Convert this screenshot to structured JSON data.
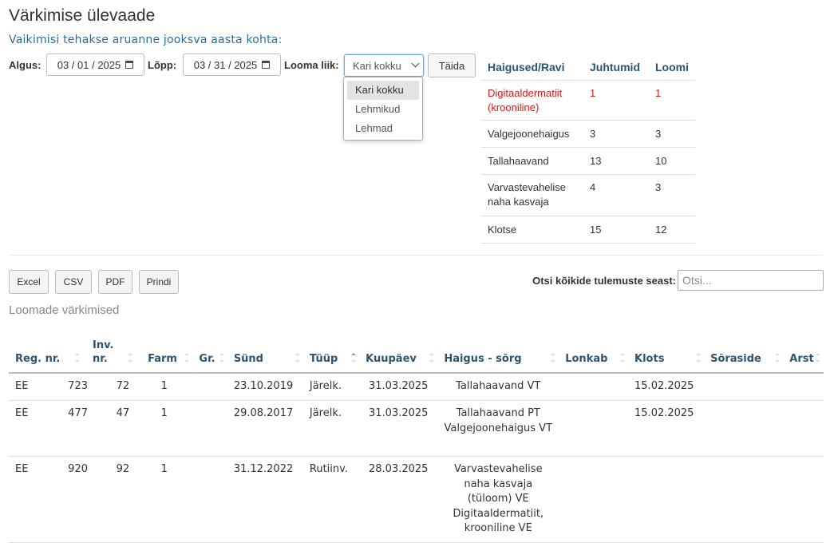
{
  "page": {
    "title": "Värkimise ülevaade",
    "subtitle": "Vaikimisi tehakse aruanne jooksva aasta kohta:"
  },
  "filters": {
    "start_label": "Algus:",
    "start_value": "03 / 01 / 2025",
    "end_label": "Lõpp:",
    "end_value": "03 / 31 / 2025",
    "type_label": "Looma liik:",
    "type_value": "Kari kokku",
    "type_options": [
      "Kari kokku",
      "Lehmikud",
      "Lehmad"
    ],
    "submit_label": "Täida"
  },
  "summary": {
    "headers": [
      "Haigused/Ravi",
      "Juhtumid",
      "Loomi"
    ],
    "rows": [
      {
        "name": "Digitaaldermatiit (krooniline)",
        "cases": "1",
        "animals": "1",
        "highlight": true
      },
      {
        "name": "Valgejoonehaigus",
        "cases": "3",
        "animals": "3"
      },
      {
        "name": "Tallahaavand",
        "cases": "13",
        "animals": "10"
      },
      {
        "name": "Varvastevahelise naha kasvaja",
        "cases": "4",
        "animals": "3"
      },
      {
        "name": "Klotse",
        "cases": "15",
        "animals": "12"
      }
    ]
  },
  "toolbar": {
    "excel": "Excel",
    "csv": "CSV",
    "pdf": "PDF",
    "print": "Prindi",
    "search_label": "Otsi kõikide tulemuste seast:",
    "search_placeholder": "Otsi..."
  },
  "section_title": "Loomade värkimised",
  "table": {
    "headers": [
      "Reg. nr.",
      "Inv. nr.",
      "Farm",
      "Gr.",
      "Sünd",
      "Tüüp",
      "Kuupäev",
      "Haigus - sõrg",
      "Lonkab",
      "Klots",
      "Sõraside",
      "Arst"
    ],
    "rows": [
      {
        "reg_cc": "EE",
        "reg_nr": "723",
        "inv": "72",
        "farm": "1",
        "gr": "",
        "born": "23.10.2019",
        "type": "Järelk.",
        "date": "31.03.2025",
        "disease": "Tallahaavand VT",
        "lame": "",
        "block": "15.02.2025",
        "bandage": "",
        "vet": ""
      },
      {
        "reg_cc": "EE",
        "reg_nr": "477",
        "inv": "47",
        "farm": "1",
        "gr": "",
        "born": "29.08.2017",
        "type": "Järelk.",
        "date": "31.03.2025",
        "disease": "Tallahaavand PT Valgejoonehaigus VT",
        "lame": "",
        "block": "15.02.2025",
        "bandage": "",
        "vet": ""
      },
      {
        "reg_cc": "EE",
        "reg_nr": "920",
        "inv": "92",
        "farm": "1",
        "gr": "",
        "born": "31.12.2022",
        "type": "Rutiinv.",
        "date": "28.03.2025",
        "disease": "Varvastevahelise naha kasvaja (tüloom) VE Digitaaldermatiit, krooniline VE",
        "lame": "",
        "block": "",
        "bandage": "",
        "vet": ""
      }
    ]
  },
  "colors": {
    "header_text": "#2e5570",
    "subtitle": "#2a6f97",
    "highlight": "#d21a1a"
  }
}
